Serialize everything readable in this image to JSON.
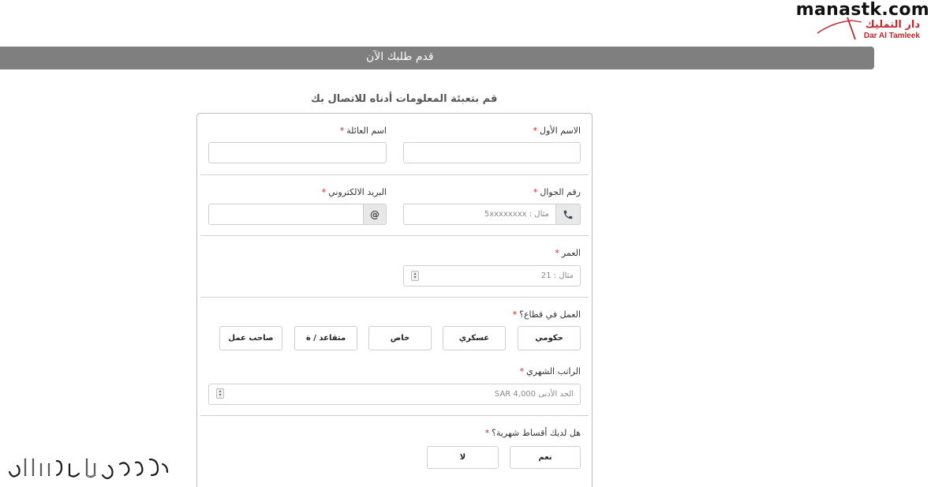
{
  "logo": {
    "site_name": "manastk.com",
    "brand_arabic": "دار التمليك",
    "brand_english": "Dar Al Tamleek",
    "accent_color": "#c0272d"
  },
  "header": {
    "title": "قدم طلبك الآن",
    "bar_color": "#7f7f7f"
  },
  "subtitle": "قم بتعبئة المعلومات أدناه للاتصال بك",
  "form": {
    "required_marker": "*",
    "required_color": "#d9232a",
    "first_name": {
      "label": "الاسم الأول",
      "value": ""
    },
    "family_name": {
      "label": "اسم العائلة",
      "value": ""
    },
    "mobile": {
      "label": "رقم الجوال",
      "placeholder": "مثال : 5xxxxxxxx",
      "icon": "phone-icon"
    },
    "email": {
      "label": "البريد الالكتروني",
      "value": "",
      "icon": "at-icon",
      "icon_glyph": "@"
    },
    "age": {
      "label": "العمر",
      "placeholder": "مثال : 21"
    },
    "sector": {
      "label": "العمل في قطاع؟",
      "options": [
        "حكومي",
        "عسكري",
        "خاص",
        "متقاعد / ة",
        "صاحب عمل"
      ]
    },
    "salary": {
      "label": "الراتب الشهري",
      "placeholder": "الحد الأدنى SAR 4,000"
    },
    "installments": {
      "label": "هل لديك أقساط شهرية؟",
      "options": [
        "نعم",
        "لا"
      ]
    }
  }
}
